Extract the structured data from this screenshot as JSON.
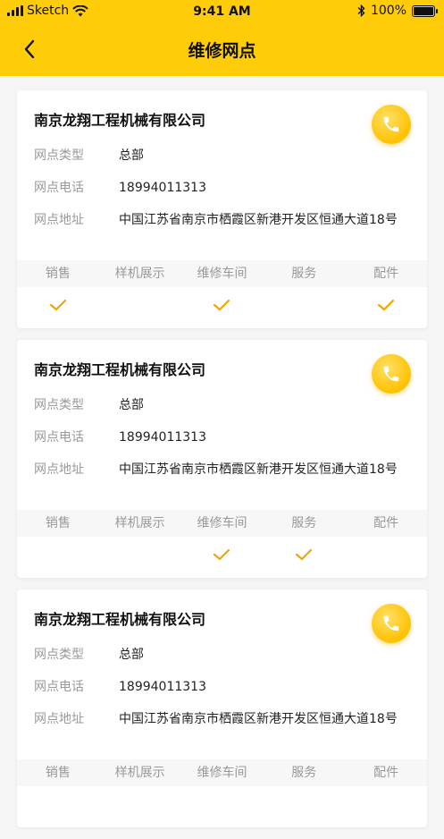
{
  "status": {
    "carrier": "Sketch",
    "time": "9:41 AM",
    "battery": "100%"
  },
  "nav": {
    "title": "维修网点"
  },
  "labels": {
    "type": "网点类型",
    "phone": "网点电话",
    "address": "网点地址"
  },
  "services": [
    "销售",
    "样机展示",
    "维修车间",
    "服务",
    "配件"
  ],
  "cards": [
    {
      "name": "南京龙翔工程机械有限公司",
      "type": "总部",
      "phone": "18994011313",
      "address": "中国江苏省南京市栖霞区新港开发区恒通大道18号",
      "checks": [
        true,
        false,
        true,
        false,
        true
      ]
    },
    {
      "name": "南京龙翔工程机械有限公司",
      "type": "总部",
      "phone": "18994011313",
      "address": "中国江苏省南京市栖霞区新港开发区恒通大道18号",
      "checks": [
        false,
        false,
        true,
        true,
        false
      ]
    },
    {
      "name": "南京龙翔工程机械有限公司",
      "type": "总部",
      "phone": "18994011313",
      "address": "中国江苏省南京市栖霞区新港开发区恒通大道18号",
      "checks": [
        false,
        false,
        false,
        false,
        false
      ]
    }
  ],
  "colors": {
    "header": "#ffcc0a",
    "accent": "#f0a500",
    "phone": "#ffc100"
  }
}
